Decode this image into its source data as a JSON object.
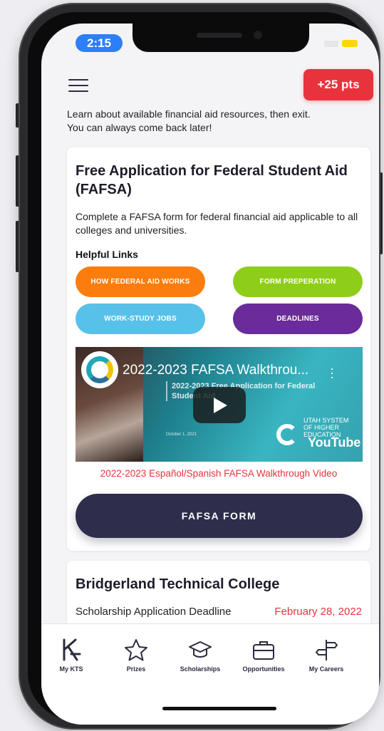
{
  "status_bar": {
    "time": "2:15"
  },
  "header": {
    "points_badge": "+25 pts"
  },
  "intro": {
    "line1": "Learn about available financial aid resources, then exit.",
    "line2": "You can always come back later!"
  },
  "fafsa_card": {
    "title": "Free Application for Federal Student Aid (FAFSA)",
    "description": "Complete a FAFSA form for federal financial aid applicable to all colleges and universities.",
    "helpful_links_heading": "Helpful Links",
    "links": [
      {
        "label": "HOW FEDERAL AID WORKS",
        "color": "#fb7d0e"
      },
      {
        "label": "FORM PREPERATION",
        "color": "#8ece1a"
      },
      {
        "label": "WORK-STUDY JOBS",
        "color": "#57c1ea"
      },
      {
        "label": "DEADLINES",
        "color": "#6a2c9a"
      }
    ],
    "video": {
      "title": "2022-2023 FAFSA Walkthrou...",
      "subtitle": "2022-2023 Free Application for Federal Student Aid",
      "date": "October 1, 2021",
      "brand_text": "UTAH SYSTEM OF HIGHER EDUCATION",
      "platform": "YouTube"
    },
    "spanish_link": "2022-2023 Español/Spanish FAFSA Walkthrough Video",
    "form_button": "FAFSA FORM"
  },
  "college_card": {
    "title": "Bridgerland Technical College",
    "deadline_label": "Scholarship Application Deadline",
    "deadline_date": "February 28, 2022"
  },
  "tab_bar": {
    "tabs": [
      {
        "label": "My KTS",
        "icon": "kts-logo-icon"
      },
      {
        "label": "Prizes",
        "icon": "star-icon"
      },
      {
        "label": "Scholarships",
        "icon": "graduation-cap-icon"
      },
      {
        "label": "Opportunities",
        "icon": "briefcase-icon"
      },
      {
        "label": "My Careers",
        "icon": "signpost-icon"
      }
    ]
  },
  "colors": {
    "accent_red": "#e8333d",
    "navy": "#2e2d4c",
    "time_pill": "#2d7ff9"
  }
}
